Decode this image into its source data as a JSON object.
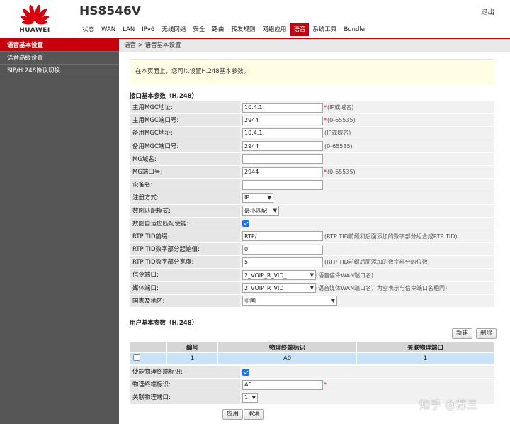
{
  "header": {
    "brand": "HUAWEI",
    "model": "HS8546V",
    "logout_label": "退出",
    "accent_color": "#c7000b"
  },
  "nav": {
    "items": [
      "状态",
      "WAN",
      "LAN",
      "IPv6",
      "无线网络",
      "安全",
      "路由",
      "转发规则",
      "网络应用",
      "语音",
      "系统工具",
      "Bundle"
    ],
    "active": "语音"
  },
  "sidebar": {
    "items": [
      "语音基本设置",
      "语音高级设置",
      "SIP/H.248协议切换"
    ],
    "active": "语音基本设置"
  },
  "breadcrumb": "语音 > 语音基本设置",
  "info_text": "在本页面上，您可以设置H.248基本参数。",
  "interface_section": {
    "title": "接口基本参数（H.248）",
    "rows": [
      {
        "label": "主用MGC地址:",
        "value": "10.4.1.",
        "required": true,
        "hint": "(IP或域名)"
      },
      {
        "label": "主用MGC端口号:",
        "value": "2944",
        "required": true,
        "hint": "(0-65535)"
      },
      {
        "label": "备用MGC地址:",
        "value": "10.4.1.",
        "required": false,
        "hint": "(IP或域名)"
      },
      {
        "label": "备用MGC端口号:",
        "value": "2944",
        "required": false,
        "hint": "(0-65535)"
      },
      {
        "label": "MG域名:",
        "value": "",
        "required": false,
        "hint": ""
      },
      {
        "label": "MG端口号:",
        "value": "2944",
        "required": true,
        "hint": "(0-65535)"
      },
      {
        "label": "设备名:",
        "value": "",
        "required": false,
        "hint": ""
      },
      {
        "label": "注册方式:",
        "select": "IP"
      },
      {
        "label": "数图匹配模式:",
        "select": "最小匹配"
      },
      {
        "label": "数图自适应匹配使能:",
        "checkbox": true
      },
      {
        "label": "RTP TID前缀:",
        "value": "RTP/",
        "required": false,
        "hint": "(RTP TID前缀和后面添加的数字部分组合成RTP TID)"
      },
      {
        "label": "RTP TID数字部分起始值:",
        "value": "0",
        "required": false,
        "hint": ""
      },
      {
        "label": "RTP TID数字部分宽度:",
        "value": "5",
        "required": false,
        "hint": "(RTP TID前缀后面添加的数字部分的位数)"
      },
      {
        "label": "信令端口:",
        "select": "2_VOIP_R_VID_",
        "hint": "(语音信令WAN端口名)"
      },
      {
        "label": "媒体端口:",
        "select": "2_VOIP_R_VID_",
        "hint": "(语音媒体WAN端口名，为空表示与信令端口名相同)"
      },
      {
        "label": "国家及地区:",
        "select": "中国"
      }
    ]
  },
  "user_section": {
    "title": "用户基本参数（H.248）",
    "new_label": "新建",
    "delete_label": "删除",
    "columns": [
      "编号",
      "物理终端标识",
      "关联物理端口"
    ],
    "rows": [
      {
        "id": "1",
        "terminal": "A0",
        "port": "1"
      }
    ],
    "detail_rows": [
      {
        "label": "使能物理终端标识:",
        "checkbox": true
      },
      {
        "label": "物理终端标识:",
        "value": "A0",
        "required": true
      },
      {
        "label": "关联物理端口:",
        "select": "1"
      }
    ],
    "apply_label": "应用",
    "cancel_label": "取消"
  },
  "watermark": "知乎 @苏三"
}
